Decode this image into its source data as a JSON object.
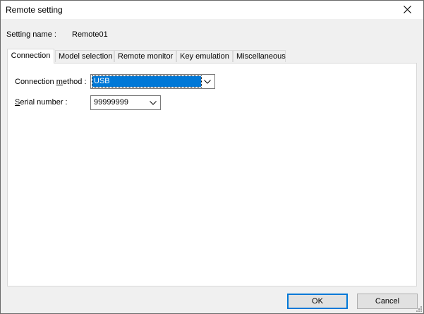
{
  "window": {
    "title": "Remote setting"
  },
  "setting": {
    "label": "Setting name :",
    "value": "Remote01"
  },
  "tabs": [
    {
      "label": "Connection",
      "active": true
    },
    {
      "label": "Model selection",
      "active": false
    },
    {
      "label": "Remote monitor",
      "active": false
    },
    {
      "label": "Key emulation",
      "active": false
    },
    {
      "label": "Miscellaneous",
      "active": false
    }
  ],
  "connection": {
    "method_label_pre": "Connection ",
    "method_label_ul": "m",
    "method_label_post": "ethod :",
    "method_value": "USB",
    "serial_label_ul": "S",
    "serial_label_post": "erial number :",
    "serial_value": "99999999"
  },
  "buttons": {
    "ok": "OK",
    "cancel": "Cancel"
  },
  "icons": {
    "close": "close-icon",
    "dropdown": "chevron-down-icon",
    "grip": "size-grip-icon"
  }
}
